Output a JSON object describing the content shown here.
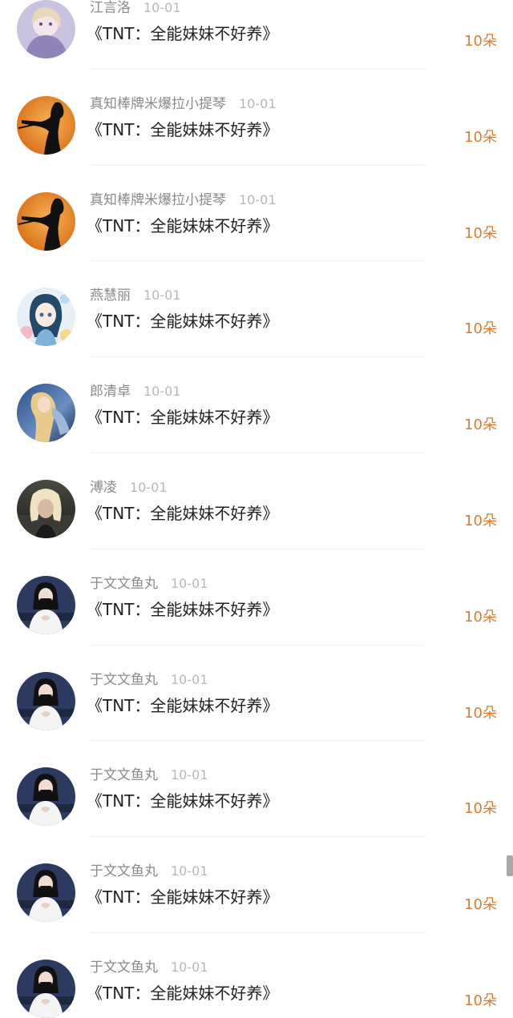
{
  "gifts": [
    {
      "user": "江言洛",
      "date": "10-01",
      "novel": "《TNT：全能妹妹不好养》",
      "amount": "10朵",
      "avatar_icon": "anime-girl-avatar-icon"
    },
    {
      "user": "真知棒牌米爆拉小提琴",
      "date": "10-01",
      "novel": "《TNT：全能妹妹不好养》",
      "amount": "10朵",
      "avatar_icon": "violinist-silhouette-avatar-icon"
    },
    {
      "user": "真知棒牌米爆拉小提琴",
      "date": "10-01",
      "novel": "《TNT：全能妹妹不好养》",
      "amount": "10朵",
      "avatar_icon": "violinist-silhouette-avatar-icon"
    },
    {
      "user": "燕慧丽",
      "date": "10-01",
      "novel": "《TNT：全能妹妹不好养》",
      "amount": "10朵",
      "avatar_icon": "anime-girl-flowers-avatar-icon"
    },
    {
      "user": "郎清卓",
      "date": "10-01",
      "novel": "《TNT：全能妹妹不好养》",
      "amount": "10朵",
      "avatar_icon": "fantasy-art-avatar-icon"
    },
    {
      "user": "溥凌",
      "date": "10-01",
      "novel": "《TNT：全能妹妹不好养》",
      "amount": "10朵",
      "avatar_icon": "blonde-portrait-avatar-icon"
    },
    {
      "user": "于文文鱼丸",
      "date": "10-01",
      "novel": "《TNT：全能妹妹不好养》",
      "amount": "10朵",
      "avatar_icon": "masked-singer-avatar-icon"
    },
    {
      "user": "于文文鱼丸",
      "date": "10-01",
      "novel": "《TNT：全能妹妹不好养》",
      "amount": "10朵",
      "avatar_icon": "masked-singer-avatar-icon"
    },
    {
      "user": "于文文鱼丸",
      "date": "10-01",
      "novel": "《TNT：全能妹妹不好养》",
      "amount": "10朵",
      "avatar_icon": "masked-singer-avatar-icon"
    },
    {
      "user": "于文文鱼丸",
      "date": "10-01",
      "novel": "《TNT：全能妹妹不好养》",
      "amount": "10朵",
      "avatar_icon": "masked-singer-avatar-icon"
    },
    {
      "user": "于文文鱼丸",
      "date": "10-01",
      "novel": "《TNT：全能妹妹不好养》",
      "amount": "10朵",
      "avatar_icon": "masked-singer-avatar-icon"
    }
  ],
  "colors": {
    "amount": "#e07a2e",
    "username": "#8a8a8a",
    "date": "#b8b8b8",
    "title": "#222222",
    "divider": "#efefef"
  }
}
